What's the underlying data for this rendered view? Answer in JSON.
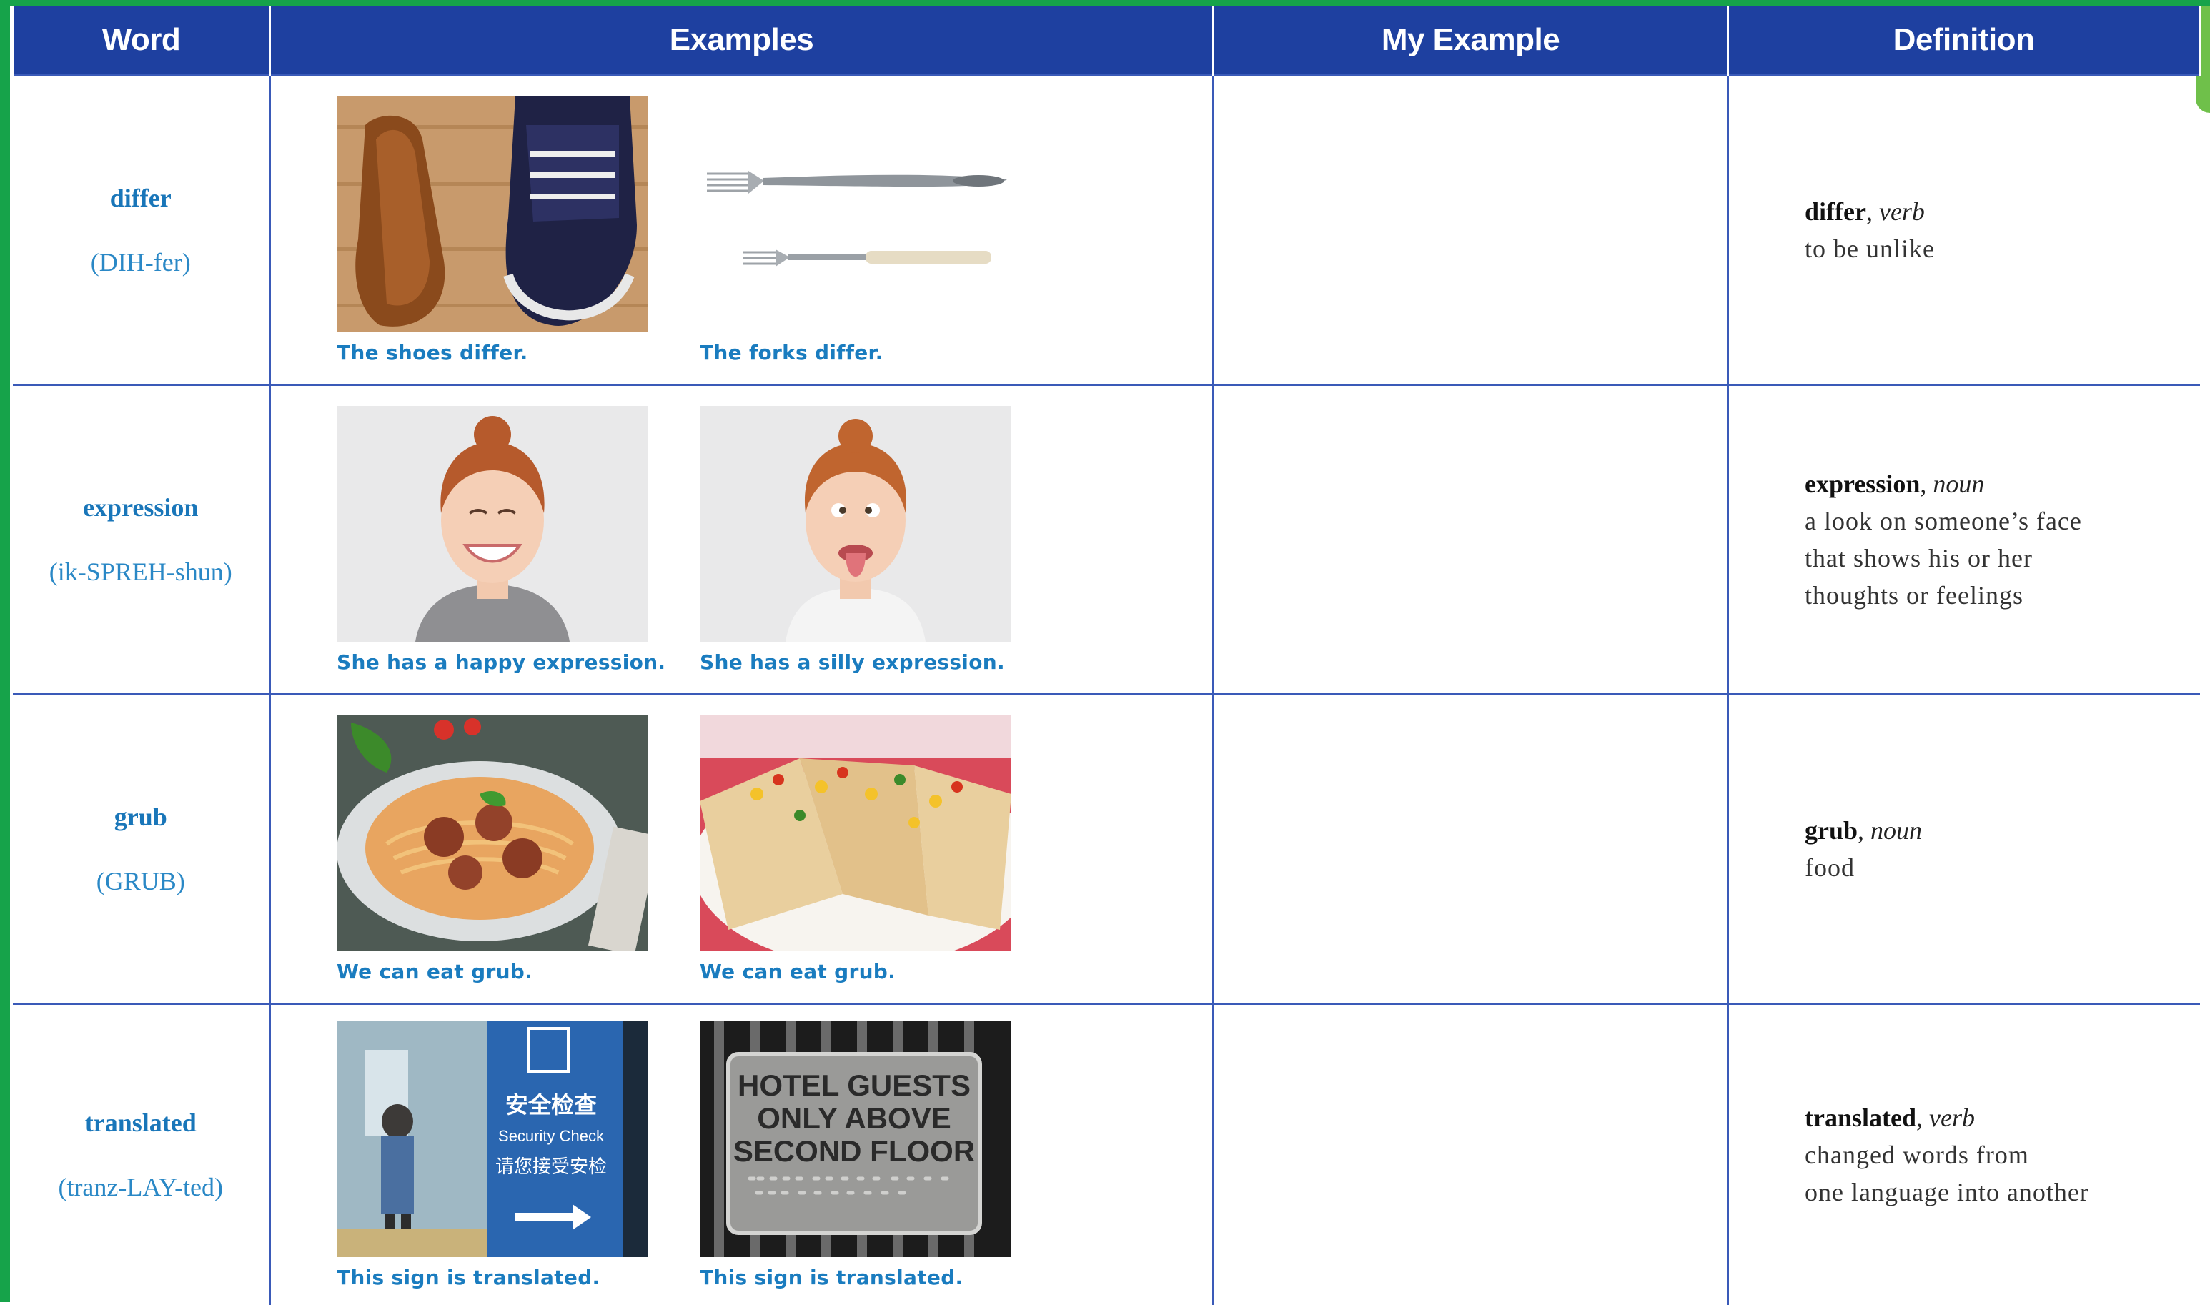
{
  "header": {
    "word": "Word",
    "examples": "Examples",
    "my_example": "My Example",
    "definition": "Definition"
  },
  "rows": [
    {
      "word": "differ",
      "pronunciation": "(DIH-fer)",
      "examples": [
        {
          "caption": "The shoes differ.",
          "image": "brown-shoe-and-sneaker-photo"
        },
        {
          "caption": "The forks differ.",
          "image": "two-forks-photo"
        }
      ],
      "my_example": "",
      "definition": {
        "headword": "differ",
        "pos": "verb",
        "text": "to be unlike"
      }
    },
    {
      "word": "expression",
      "pronunciation": "(ik-SPREH-shun)",
      "examples": [
        {
          "caption": "She has a happy expression.",
          "image": "smiling-woman-photo"
        },
        {
          "caption": "She has a silly expression.",
          "image": "woman-tongue-out-photo"
        }
      ],
      "my_example": "",
      "definition": {
        "headword": "expression",
        "pos": "noun",
        "text": "a look on someone’s face\nthat shows his or her\nthoughts or feelings"
      }
    },
    {
      "word": "grub",
      "pronunciation": "(GRUB)",
      "examples": [
        {
          "caption": "We can eat grub.",
          "image": "spaghetti-meatballs-photo"
        },
        {
          "caption": "We can eat grub.",
          "image": "quesadilla-photo"
        }
      ],
      "my_example": "",
      "definition": {
        "headword": "grub",
        "pos": "noun",
        "text": "food"
      }
    },
    {
      "word": "translated",
      "pronunciation": "(tranz-LAY-ted)",
      "examples": [
        {
          "caption": "This sign is translated.",
          "image": "security-check-sign-photo",
          "sign_text": {
            "chinese_top": "安全检查",
            "english": "Security Check",
            "chinese_bottom": "请您接受安检"
          }
        },
        {
          "caption": "This sign is translated.",
          "image": "hotel-guests-braille-sign-photo",
          "sign_text": {
            "line1": "HOTEL GUESTS",
            "line2": "ONLY ABOVE",
            "line3": "SECOND FLOOR"
          }
        }
      ],
      "my_example": "",
      "definition": {
        "headword": "translated",
        "pos": "verb",
        "text": "changed words from\none language into another"
      }
    }
  ],
  "colors": {
    "header_bg": "#1e40a0",
    "word_blue": "#1976b9",
    "caption_blue": "#1a7cbf",
    "grid": "#3a5ab8",
    "frame_green": "#16a34a"
  }
}
